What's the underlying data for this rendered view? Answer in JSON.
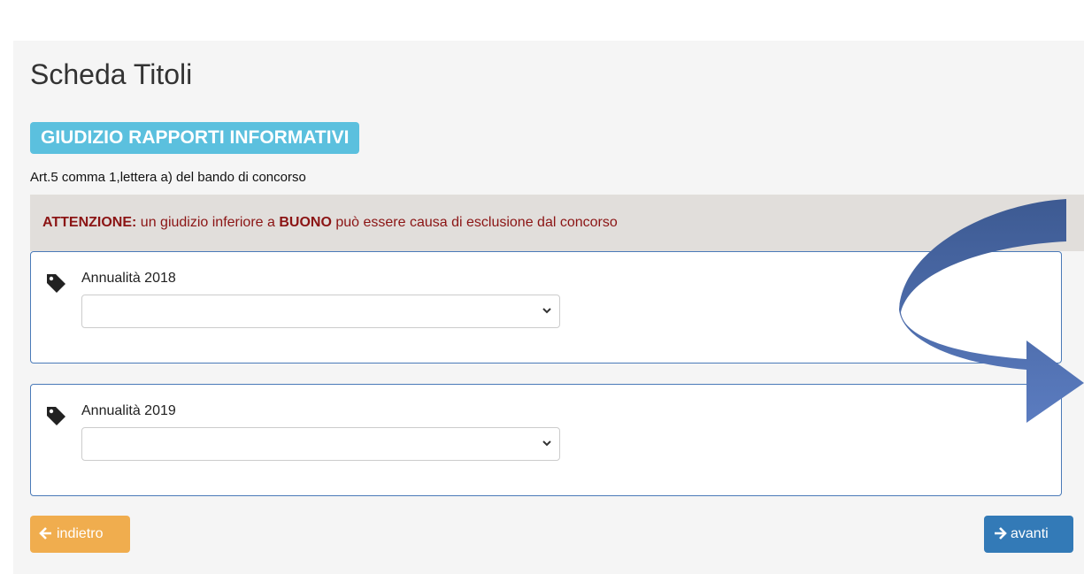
{
  "page": {
    "title": "Scheda Titoli",
    "section_label": "GIUDIZIO RAPPORTI INFORMATIVI",
    "subtitle": "Art.5 comma 1,lettera a) del bando di concorso"
  },
  "alert": {
    "prefix": "ATTENZIONE:",
    "text_before": " un giudizio inferiore a ",
    "emphasis": "BUONO",
    "text_after": " può essere causa di esclusione dal concorso"
  },
  "fields": [
    {
      "label": "Annualità 2018",
      "value": "",
      "icon": "tag-icon"
    },
    {
      "label": "Annualità 2019",
      "value": "",
      "icon": "tag-icon"
    }
  ],
  "buttons": {
    "back_label": "indietro",
    "next_label": "avanti"
  },
  "colors": {
    "section_label_bg": "#5bc0de",
    "alert_text": "#8b1414",
    "back_button": "#f0ad4e",
    "next_button": "#337ab7",
    "annotation_arrow": "#4a6aa8"
  },
  "annotation": {
    "icon": "curved-arrow-icon"
  }
}
